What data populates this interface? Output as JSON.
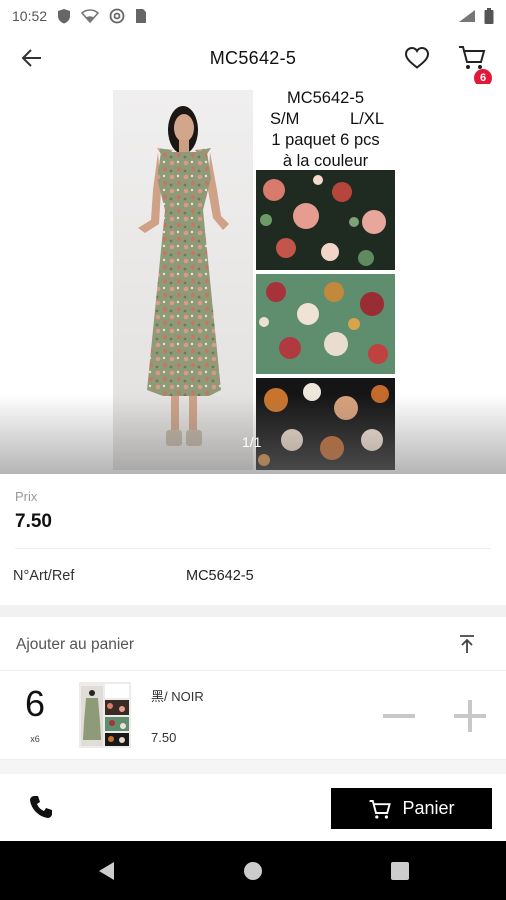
{
  "status_bar": {
    "time": "10:52",
    "icons": [
      "shield-icon",
      "wifi-icon",
      "at-sign-icon",
      "sim-card-icon"
    ],
    "right_icons": [
      "signal-icon",
      "battery-icon"
    ]
  },
  "app_bar": {
    "title": "MC5642-5",
    "back_icon": "arrow-left-icon",
    "favorite_icon": "heart-icon",
    "cart_icon": "cart-icon",
    "cart_badge": "6"
  },
  "product_image": {
    "caption": {
      "line1": "MC5642-5",
      "size1": "S/M",
      "size2": "L/XL",
      "line3": "1 paquet 6 pcs",
      "line4": "à la couleur"
    },
    "counter": "1/1"
  },
  "price": {
    "label": "Prix",
    "value": "7.50"
  },
  "reference": {
    "label": "N°Art/Ref",
    "value": "MC5642-5"
  },
  "add_to_cart": {
    "title": "Ajouter au panier",
    "collapse_icon": "collapse-up-icon",
    "item": {
      "quantity": "6",
      "multiplier": "x6",
      "color": "黑/ NOIR",
      "price": "7.50",
      "minus_icon": "minus-icon",
      "plus_icon": "plus-icon"
    }
  },
  "bottom_bar": {
    "phone_icon": "phone-icon",
    "panier_label": "Panier"
  },
  "nav_bar": {
    "icons": [
      "back-triangle-icon",
      "home-circle-icon",
      "recents-square-icon"
    ]
  },
  "colors": {
    "badge": "#e2173a",
    "button": "#000000",
    "divider": "#eeeeee",
    "muted_text": "#999999"
  }
}
